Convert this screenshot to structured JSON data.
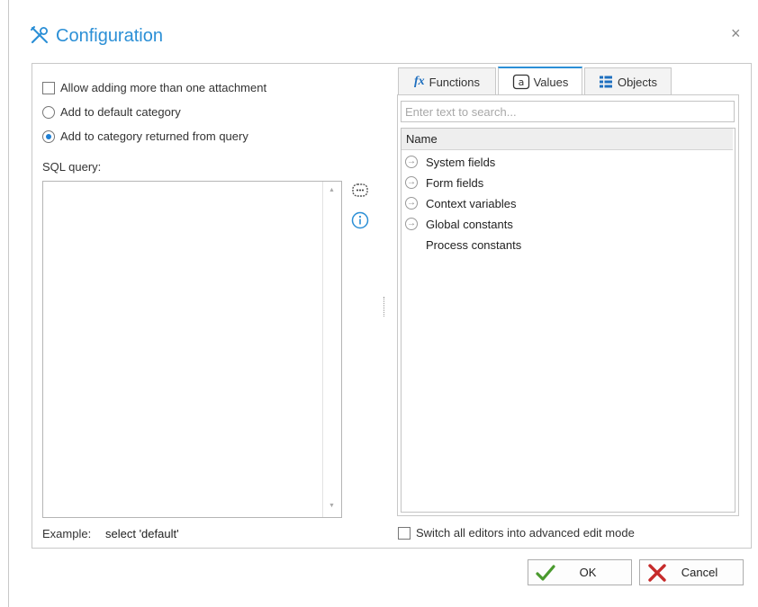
{
  "dialog": {
    "title": "Configuration",
    "title_icon": "tools-icon",
    "close_label": "×",
    "accent_color": "#2b8fd6"
  },
  "left": {
    "allow_multiple": {
      "label": "Allow adding more than one attachment",
      "checked": false
    },
    "radio_default": {
      "label": "Add to default category",
      "selected": false
    },
    "radio_query": {
      "label": "Add to category returned from query",
      "selected": true
    },
    "sql_label": "SQL query:",
    "sql_value": "",
    "example_label": "Example:",
    "example_value": "select 'default'"
  },
  "right": {
    "tabs": [
      {
        "label": "Functions",
        "icon": "fx-icon",
        "active": false
      },
      {
        "label": "Values",
        "icon": "at-icon",
        "active": true
      },
      {
        "label": "Objects",
        "icon": "objects-icon",
        "active": false
      }
    ],
    "search_placeholder": "Enter text to search...",
    "column_header": "Name",
    "tree_items": [
      {
        "label": "System fields",
        "expandable": true
      },
      {
        "label": "Form fields",
        "expandable": true
      },
      {
        "label": "Context variables",
        "expandable": true
      },
      {
        "label": "Global constants",
        "expandable": true
      },
      {
        "label": "Process constants",
        "expandable": false
      }
    ],
    "advanced_mode": {
      "label": "Switch all editors into advanced edit mode",
      "checked": false
    }
  },
  "buttons": {
    "ok_label": "OK",
    "cancel_label": "Cancel"
  }
}
